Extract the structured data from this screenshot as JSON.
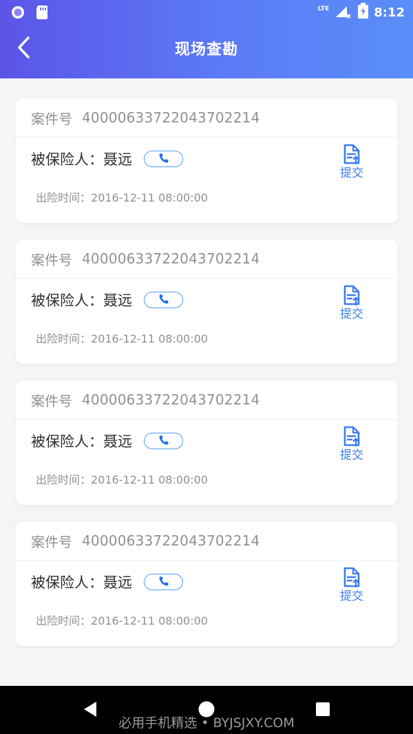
{
  "status_bar": {
    "time": "8:12",
    "network": "LTE",
    "left_icons": [
      "notification-circle-icon",
      "sd-card-icon"
    ],
    "right_icons": [
      "signal-icon",
      "battery-icon"
    ]
  },
  "header": {
    "title": "现场查勘",
    "back_icon": "chevron-left-icon",
    "gradient": [
      "#5b55e8",
      "#5a8ef8"
    ]
  },
  "cases": [
    {
      "case_label": "案件号",
      "case_no": "40000633722043702214",
      "insured_label": "被保险人：",
      "insured_name": "聂远",
      "time_label": "出险时间：",
      "time": "2016-12-11 08:00:00",
      "submit_label": "提交"
    },
    {
      "case_label": "案件号",
      "case_no": "40000633722043702214",
      "insured_label": "被保险人：",
      "insured_name": "聂远",
      "time_label": "出险时间：",
      "time": "2016-12-11 08:00:00",
      "submit_label": "提交"
    },
    {
      "case_label": "案件号",
      "case_no": "40000633722043702214",
      "insured_label": "被保险人：",
      "insured_name": "聂远",
      "time_label": "出险时间：",
      "time": "2016-12-11 08:00:00",
      "submit_label": "提交"
    },
    {
      "case_label": "案件号",
      "case_no": "40000633722043702214",
      "insured_label": "被保险人：",
      "insured_name": "聂远",
      "time_label": "出险时间：",
      "time": "2016-12-11 08:00:00",
      "submit_label": "提交"
    }
  ],
  "icons": {
    "phone": "phone-icon",
    "submit": "document-upload-icon"
  },
  "nav_bar": {
    "buttons": [
      "back-triangle-icon",
      "home-circle-icon",
      "recents-square-icon"
    ]
  },
  "watermark": "必用手机精选 • BYJSJXY.COM",
  "colors": {
    "accent": "#3d7cf0",
    "phone_border": "#4f9bf3",
    "text_primary": "#2b2d33",
    "text_secondary": "#8e9096",
    "background": "#f4f5f7"
  }
}
